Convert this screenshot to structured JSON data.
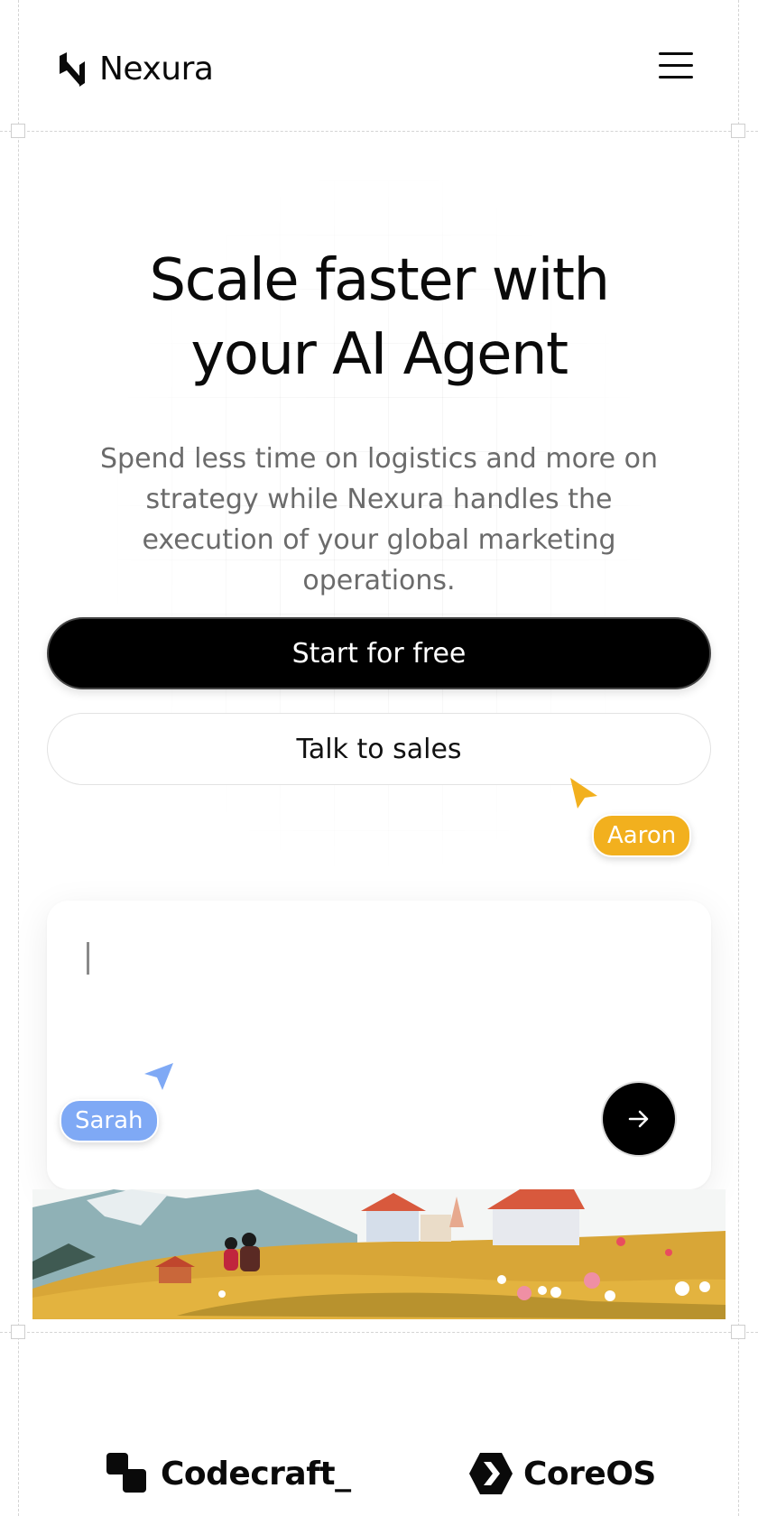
{
  "header": {
    "brand": "Nexura",
    "logo_icon": "nexura-logo-icon",
    "menu_icon": "hamburger-menu-icon"
  },
  "hero": {
    "title_line1": "Scale faster with",
    "title_line2": "your AI Agent",
    "subtitle": "Spend less time on logistics and more on strategy while Nexura handles the execution of your global marketing operations.",
    "primary_cta": "Start for free",
    "secondary_cta": "Talk to sales"
  },
  "cursors": [
    {
      "name": "Aaron",
      "color": "#F2B01E"
    },
    {
      "name": "Sarah",
      "color": "#7FA9F5"
    }
  ],
  "prompt_box": {
    "value": "",
    "send_icon": "arrow-right-icon"
  },
  "partners": [
    {
      "name": "Codecraft_",
      "icon": "codecraft-logo-icon"
    },
    {
      "name": "CoreOS",
      "icon": "coreos-logo-icon"
    }
  ],
  "colors": {
    "primary": "#000000",
    "aaron": "#F2B01E",
    "sarah": "#7FA9F5",
    "subtitle": "#6B6B6B"
  }
}
